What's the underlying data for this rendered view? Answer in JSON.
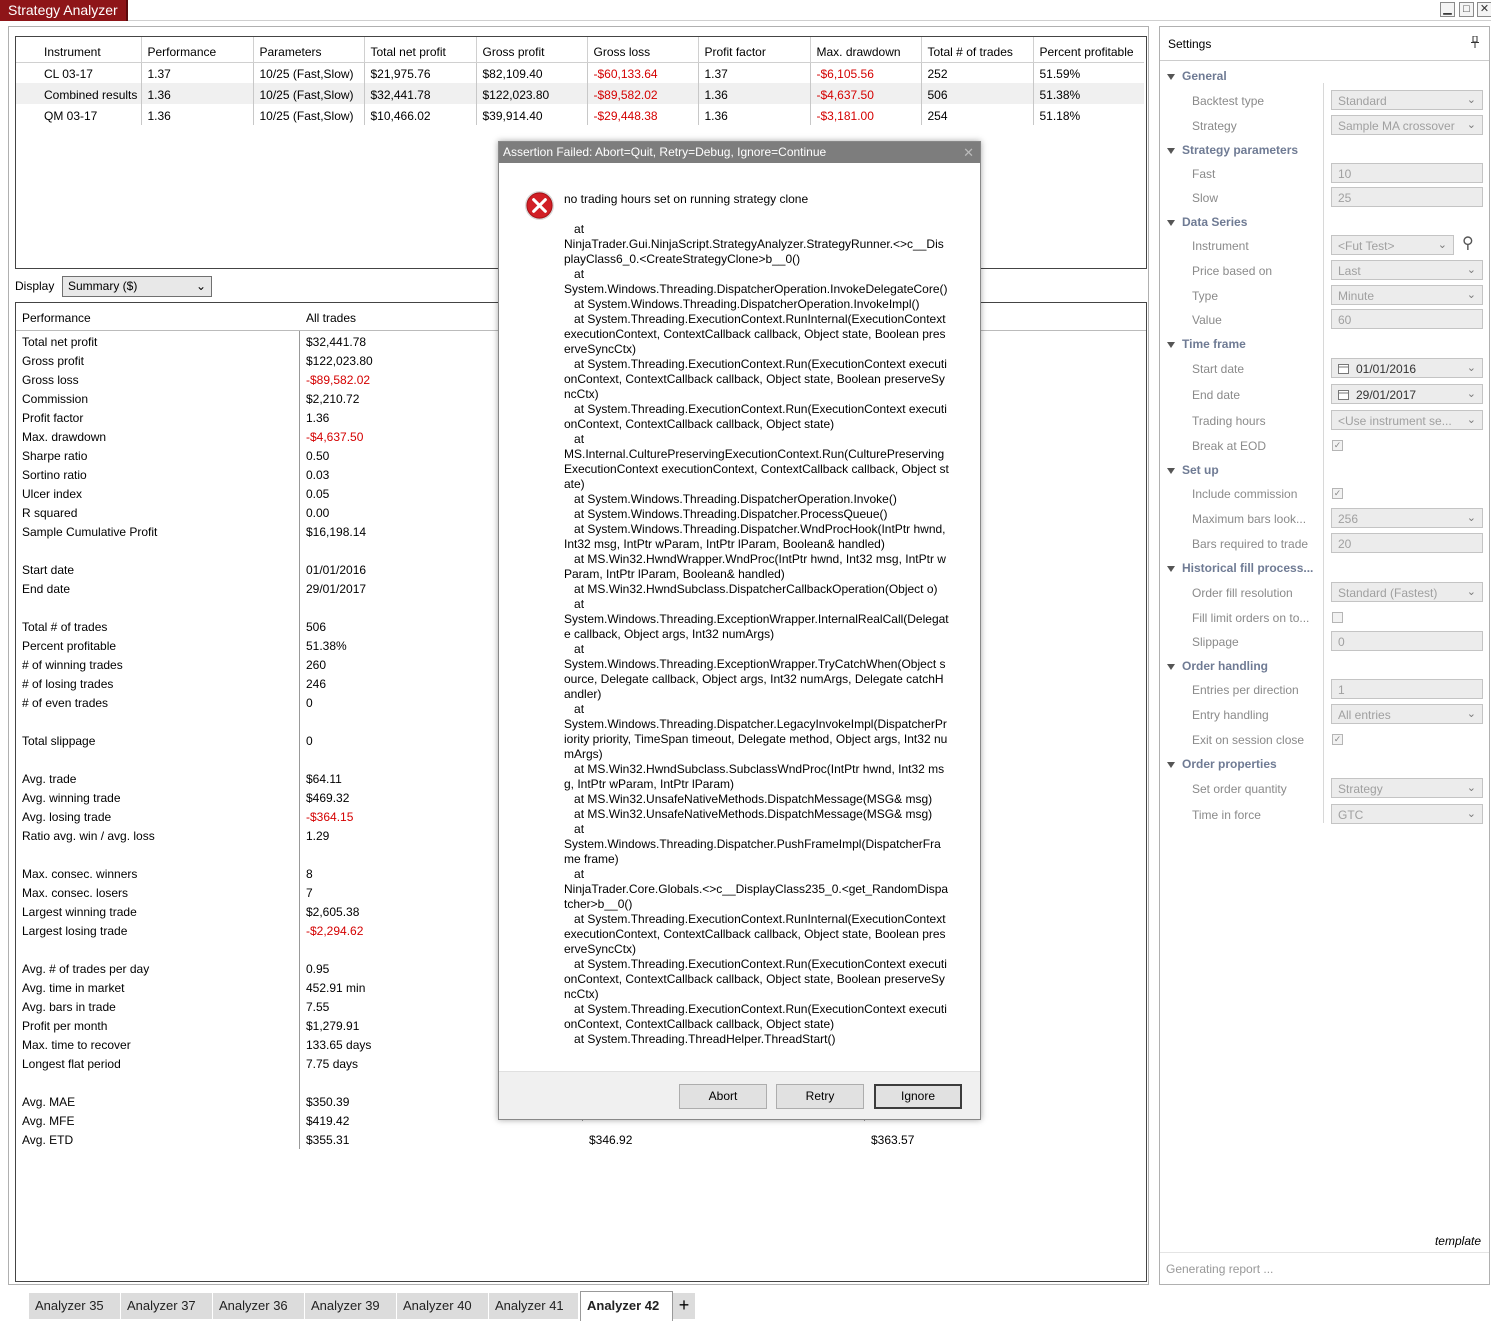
{
  "window": {
    "title": "Strategy Analyzer"
  },
  "results": {
    "headers": [
      "Instrument",
      "Performance",
      "Parameters",
      "Total net profit",
      "Gross profit",
      "Gross loss",
      "Profit factor",
      "Max. drawdown",
      "Total # of trades",
      "Percent profitable"
    ],
    "rows": [
      [
        "CL 03-17",
        "1.37",
        "10/25 (Fast,Slow)",
        "$21,975.76",
        "$82,109.40",
        "-$60,133.64",
        "1.37",
        "-$6,105.56",
        "252",
        "51.59%"
      ],
      [
        "Combined results",
        "1.36",
        "10/25 (Fast,Slow)",
        "$32,441.78",
        "$122,023.80",
        "-$89,582.02",
        "1.36",
        "-$4,637.50",
        "506",
        "51.38%"
      ],
      [
        "QM 03-17",
        "1.36",
        "10/25 (Fast,Slow)",
        "$10,466.02",
        "$39,914.40",
        "-$29,448.38",
        "1.36",
        "-$3,181.00",
        "254",
        "51.18%"
      ]
    ]
  },
  "display": {
    "label": "Display",
    "selected": "Summary ($)"
  },
  "performance": {
    "headers": [
      "Performance",
      "All trades"
    ],
    "rows": [
      {
        "label": "Total net profit",
        "v1": "$32,441.78",
        "neg": false
      },
      {
        "label": "Gross profit",
        "v1": "$122,023.80",
        "neg": false
      },
      {
        "label": "Gross loss",
        "v1": "-$89,582.02",
        "neg": true
      },
      {
        "label": "Commission",
        "v1": "$2,210.72",
        "neg": false
      },
      {
        "label": "Profit factor",
        "v1": "1.36",
        "neg": false
      },
      {
        "label": "Max. drawdown",
        "v1": "-$4,637.50",
        "neg": true
      },
      {
        "label": "Sharpe ratio",
        "v1": "0.50",
        "neg": false
      },
      {
        "label": "Sortino ratio",
        "v1": "0.03",
        "neg": false
      },
      {
        "label": "Ulcer index",
        "v1": "0.05",
        "neg": false
      },
      {
        "label": "R squared",
        "v1": "0.00",
        "neg": false
      },
      {
        "label": "Sample Cumulative Profit",
        "v1": "$16,198.14",
        "neg": false
      },
      {
        "label": "",
        "v1": "",
        "neg": false
      },
      {
        "label": "Start date",
        "v1": "01/01/2016",
        "neg": false
      },
      {
        "label": "End date",
        "v1": "29/01/2017",
        "neg": false
      },
      {
        "label": "",
        "v1": "",
        "neg": false
      },
      {
        "label": "Total # of trades",
        "v1": "506",
        "neg": false
      },
      {
        "label": "Percent profitable",
        "v1": "51.38%",
        "neg": false
      },
      {
        "label": "# of winning trades",
        "v1": "260",
        "neg": false
      },
      {
        "label": "# of losing trades",
        "v1": "246",
        "neg": false
      },
      {
        "label": "# of even trades",
        "v1": "0",
        "neg": false
      },
      {
        "label": "",
        "v1": "",
        "neg": false
      },
      {
        "label": "Total slippage",
        "v1": "0",
        "neg": false
      },
      {
        "label": "",
        "v1": "",
        "neg": false
      },
      {
        "label": "Avg. trade",
        "v1": "$64.11",
        "neg": false
      },
      {
        "label": "Avg. winning trade",
        "v1": "$469.32",
        "neg": false
      },
      {
        "label": "Avg. losing trade",
        "v1": "-$364.15",
        "neg": true
      },
      {
        "label": "Ratio avg. win / avg. loss",
        "v1": "1.29",
        "neg": false
      },
      {
        "label": "",
        "v1": "",
        "neg": false
      },
      {
        "label": "Max. consec. winners",
        "v1": "8",
        "neg": false
      },
      {
        "label": "Max. consec. losers",
        "v1": "7",
        "neg": false
      },
      {
        "label": "Largest winning trade",
        "v1": "$2,605.38",
        "neg": false
      },
      {
        "label": "Largest losing trade",
        "v1": "-$2,294.62",
        "neg": true
      },
      {
        "label": "",
        "v1": "",
        "neg": false
      },
      {
        "label": "Avg. # of trades per day",
        "v1": "0.95",
        "neg": false
      },
      {
        "label": "Avg. time in market",
        "v1": "452.91 min",
        "neg": false
      },
      {
        "label": "Avg. bars in trade",
        "v1": "7.55",
        "neg": false
      },
      {
        "label": "Profit per month",
        "v1": "$1,279.91",
        "neg": false
      },
      {
        "label": "Max. time to recover",
        "v1": "133.65 days",
        "neg": false
      },
      {
        "label": "Longest flat period",
        "v1": "7.75 days",
        "neg": false
      },
      {
        "label": "",
        "v1": "",
        "neg": false
      },
      {
        "label": "Avg. MAE",
        "v1": "$350.39",
        "neg": false
      },
      {
        "label": "Avg. MFE",
        "v1": "$419.42",
        "neg": false
      },
      {
        "label": "Avg. ETD",
        "v1": "$355.31",
        "neg": false,
        "v2": "$346.92",
        "v3": "$363.57"
      }
    ]
  },
  "dialog": {
    "title": "Assertion Failed: Abort=Quit, Retry=Debug, Ignore=Continue",
    "close_glyph": "✕",
    "message": "no trading hours set on running strategy clone\n\n   at\nNinjaTrader.Gui.NinjaScript.StrategyAnalyzer.StrategyRunner.<>c__DisplayClass6_0.<CreateStrategyClone>b__0()\n   at\nSystem.Windows.Threading.DispatcherOperation.InvokeDelegateCore()\n   at System.Windows.Threading.DispatcherOperation.InvokeImpl()\n   at System.Threading.ExecutionContext.RunInternal(ExecutionContext executionContext, ContextCallback callback, Object state, Boolean preserveSyncCtx)\n   at System.Threading.ExecutionContext.Run(ExecutionContext executionContext, ContextCallback callback, Object state, Boolean preserveSyncCtx)\n   at System.Threading.ExecutionContext.Run(ExecutionContext executionContext, ContextCallback callback, Object state)\n   at\nMS.Internal.CulturePreservingExecutionContext.Run(CulturePreservingExecutionContext executionContext, ContextCallback callback, Object state)\n   at System.Windows.Threading.DispatcherOperation.Invoke()\n   at System.Windows.Threading.Dispatcher.ProcessQueue()\n   at System.Windows.Threading.Dispatcher.WndProcHook(IntPtr hwnd, Int32 msg, IntPtr wParam, IntPtr lParam, Boolean& handled)\n   at MS.Win32.HwndWrapper.WndProc(IntPtr hwnd, Int32 msg, IntPtr wParam, IntPtr lParam, Boolean& handled)\n   at MS.Win32.HwndSubclass.DispatcherCallbackOperation(Object o)\n   at\nSystem.Windows.Threading.ExceptionWrapper.InternalRealCall(Delegate callback, Object args, Int32 numArgs)\n   at\nSystem.Windows.Threading.ExceptionWrapper.TryCatchWhen(Object source, Delegate callback, Object args, Int32 numArgs, Delegate catchHandler)\n   at\nSystem.Windows.Threading.Dispatcher.LegacyInvokeImpl(DispatcherPriority priority, TimeSpan timeout, Delegate method, Object args, Int32 numArgs)\n   at MS.Win32.HwndSubclass.SubclassWndProc(IntPtr hwnd, Int32 msg, IntPtr wParam, IntPtr lParam)\n   at MS.Win32.UnsafeNativeMethods.DispatchMessage(MSG& msg)\n   at MS.Win32.UnsafeNativeMethods.DispatchMessage(MSG& msg)\n   at\nSystem.Windows.Threading.Dispatcher.PushFrameImpl(DispatcherFrame frame)\n   at\nNinjaTrader.Core.Globals.<>c__DisplayClass235_0.<get_RandomDispatcher>b__0()\n   at System.Threading.ExecutionContext.RunInternal(ExecutionContext executionContext, ContextCallback callback, Object state, Boolean preserveSyncCtx)\n   at System.Threading.ExecutionContext.Run(ExecutionContext executionContext, ContextCallback callback, Object state, Boolean preserveSyncCtx)\n   at System.Threading.ExecutionContext.Run(ExecutionContext executionContext, ContextCallback callback, Object state)\n   at System.Threading.ThreadHelper.ThreadStart()",
    "buttons": {
      "abort": "Abort",
      "retry": "Retry",
      "ignore": "Ignore"
    }
  },
  "settings": {
    "title": "Settings",
    "sections": {
      "general": "General",
      "strategy_parameters": "Strategy parameters",
      "data_series": "Data Series",
      "time_frame": "Time frame",
      "set_up": "Set up",
      "historical_fill": "Historical fill process...",
      "order_handling": "Order handling",
      "order_properties": "Order properties"
    },
    "props": {
      "backtest_type": {
        "label": "Backtest type",
        "value": "Standard"
      },
      "strategy": {
        "label": "Strategy",
        "value": "Sample MA crossover"
      },
      "fast": {
        "label": "Fast",
        "value": "10"
      },
      "slow": {
        "label": "Slow",
        "value": "25"
      },
      "instrument": {
        "label": "Instrument",
        "value": "<Fut Test>"
      },
      "price_based_on": {
        "label": "Price based on",
        "value": "Last"
      },
      "type": {
        "label": "Type",
        "value": "Minute"
      },
      "value": {
        "label": "Value",
        "value": "60"
      },
      "start_date": {
        "label": "Start date",
        "value": "01/01/2016"
      },
      "end_date": {
        "label": "End date",
        "value": "29/01/2017"
      },
      "trading_hours": {
        "label": "Trading hours",
        "value": "<Use instrument se..."
      },
      "break_at_eod": {
        "label": "Break at EOD"
      },
      "include_commission": {
        "label": "Include commission"
      },
      "max_bars_lookback": {
        "label": "Maximum bars look...",
        "value": "256"
      },
      "bars_required": {
        "label": "Bars required to trade",
        "value": "20"
      },
      "order_fill_resolution": {
        "label": "Order fill resolution",
        "value": "Standard (Fastest)"
      },
      "fill_limit_orders": {
        "label": "Fill limit orders on to..."
      },
      "slippage": {
        "label": "Slippage",
        "value": "0"
      },
      "entries_per_direction": {
        "label": "Entries per direction",
        "value": "1"
      },
      "entry_handling": {
        "label": "Entry handling",
        "value": "All entries"
      },
      "exit_on_session_close": {
        "label": "Exit on session close"
      },
      "set_order_quantity": {
        "label": "Set order quantity",
        "value": "Strategy"
      },
      "time_in_force": {
        "label": "Time in force",
        "value": "GTC"
      }
    },
    "template_label": "template",
    "status": "Generating report ..."
  },
  "tabs": [
    "Analyzer 35",
    "Analyzer 37",
    "Analyzer 36",
    "Analyzer 39",
    "Analyzer 40",
    "Analyzer 41",
    "Analyzer 42"
  ],
  "active_tab": "Analyzer 42",
  "glyphs": {
    "add_tab": "+",
    "chevron": "⌄",
    "search": "⚲",
    "check": "✓",
    "minimize": "▁",
    "maximize": "□",
    "close": "✕"
  },
  "colors": {
    "title_tab": "#8e1518",
    "negative": "#d40000",
    "section": "#6f7b94",
    "dialog_title": "#7d7d7d"
  }
}
